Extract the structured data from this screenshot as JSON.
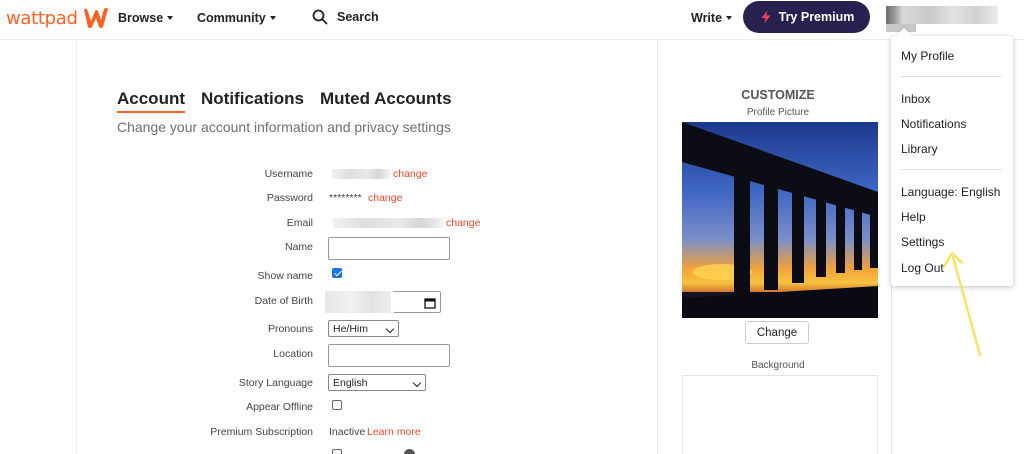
{
  "header": {
    "logo_text": "wattpad",
    "browse": "Browse",
    "community": "Community",
    "search": "Search",
    "write": "Write",
    "premium": "Try Premium",
    "brand_color": "#ff6122",
    "premium_color": "#28204e"
  },
  "tabs": {
    "account": "Account",
    "notifications": "Notifications",
    "muted": "Muted Accounts"
  },
  "subtitle": "Change your account information and privacy settings",
  "form": {
    "username_label": "Username",
    "change": "change",
    "password_label": "Password",
    "password_value": "********",
    "email_label": "Email",
    "name_label": "Name",
    "show_name_label": "Show name",
    "show_name_checked": true,
    "dob_label": "Date of Birth",
    "pronouns_label": "Pronouns",
    "pronouns_value": "He/Him",
    "location_label": "Location",
    "story_language_label": "Story Language",
    "story_language_value": "English",
    "appear_offline_label": "Appear Offline",
    "appear_offline_checked": false,
    "premium_label": "Premium Subscription",
    "premium_value": "Inactive",
    "learn_more": "Learn more"
  },
  "customize": {
    "title": "CUSTOMIZE",
    "profile_picture": "Profile Picture",
    "change_button": "Change",
    "background": "Background"
  },
  "menu": {
    "my_profile": "My Profile",
    "inbox": "Inbox",
    "notifications": "Notifications",
    "library": "Library",
    "language": "Language: English",
    "help": "Help",
    "settings": "Settings",
    "log_out": "Log Out"
  },
  "link_color": "#e8482a",
  "annotation_color": "#f7e36a"
}
